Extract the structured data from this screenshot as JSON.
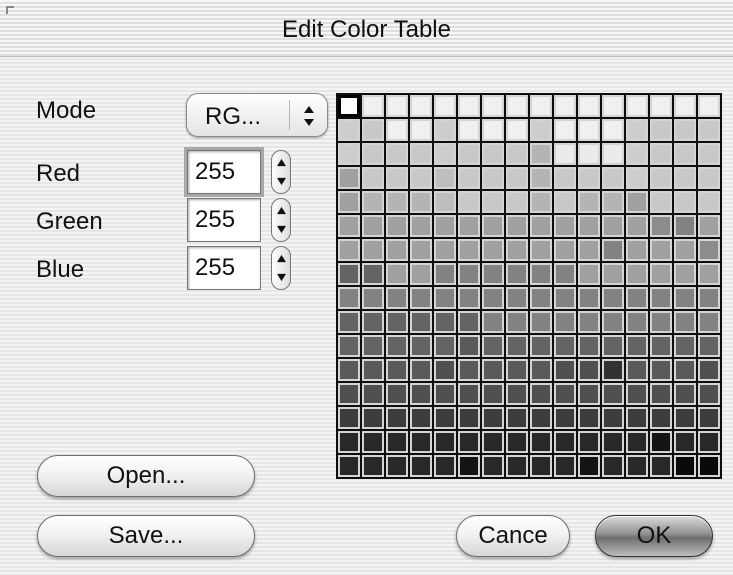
{
  "window": {
    "title": "Edit Color Table"
  },
  "mode": {
    "label": "Mode",
    "value": "RG..."
  },
  "fields": [
    {
      "label": "Red",
      "value": "255"
    },
    {
      "label": "Green",
      "value": "255"
    },
    {
      "label": "Blue",
      "value": "255"
    }
  ],
  "buttons": {
    "open": "Open...",
    "save": "Save...",
    "cancel": "Cance",
    "ok": "OK"
  },
  "color_table": {
    "rows": 16,
    "cols": 16,
    "selected_index": 0,
    "grays": [
      255,
      240,
      240,
      240,
      240,
      240,
      240,
      240,
      240,
      240,
      240,
      240,
      240,
      240,
      240,
      240,
      205,
      200,
      240,
      240,
      205,
      240,
      240,
      240,
      205,
      240,
      240,
      240,
      205,
      200,
      200,
      200,
      205,
      200,
      200,
      200,
      205,
      200,
      200,
      200,
      180,
      235,
      235,
      235,
      205,
      200,
      200,
      200,
      160,
      200,
      200,
      200,
      190,
      200,
      200,
      200,
      180,
      200,
      200,
      200,
      205,
      200,
      200,
      200,
      160,
      180,
      180,
      180,
      190,
      200,
      200,
      200,
      180,
      200,
      180,
      180,
      160,
      200,
      200,
      200,
      160,
      160,
      160,
      160,
      160,
      160,
      160,
      160,
      160,
      160,
      160,
      160,
      160,
      140,
      130,
      160,
      160,
      160,
      160,
      160,
      160,
      160,
      160,
      160,
      160,
      160,
      160,
      130,
      160,
      160,
      160,
      140,
      100,
      100,
      160,
      160,
      130,
      130,
      130,
      130,
      130,
      130,
      160,
      160,
      160,
      160,
      160,
      160,
      130,
      130,
      130,
      130,
      130,
      130,
      130,
      130,
      130,
      130,
      130,
      130,
      130,
      130,
      130,
      130,
      100,
      100,
      100,
      100,
      100,
      100,
      130,
      130,
      130,
      130,
      130,
      130,
      130,
      130,
      130,
      130,
      100,
      100,
      100,
      100,
      100,
      90,
      100,
      100,
      100,
      100,
      100,
      100,
      100,
      100,
      100,
      100,
      90,
      90,
      90,
      90,
      80,
      90,
      90,
      90,
      90,
      80,
      80,
      50,
      90,
      90,
      90,
      80,
      80,
      80,
      80,
      80,
      80,
      80,
      80,
      80,
      80,
      80,
      80,
      80,
      80,
      80,
      80,
      80,
      60,
      60,
      60,
      60,
      60,
      60,
      60,
      60,
      60,
      60,
      60,
      60,
      60,
      60,
      60,
      60,
      40,
      40,
      40,
      40,
      40,
      40,
      40,
      40,
      40,
      40,
      40,
      40,
      40,
      20,
      40,
      40,
      40,
      40,
      40,
      40,
      40,
      20,
      40,
      40,
      40,
      40,
      20,
      40,
      40,
      40,
      10,
      10
    ]
  }
}
